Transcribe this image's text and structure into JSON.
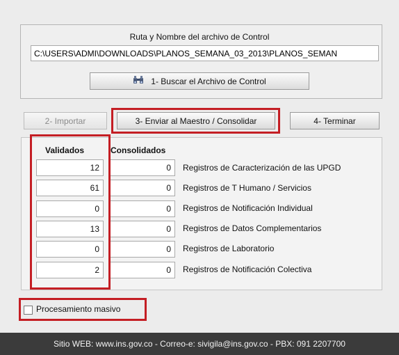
{
  "control_file": {
    "label": "Ruta y Nombre del archivo de Control",
    "path_value": "C:\\USERS\\ADMI\\DOWNLOADS\\PLANOS_SEMANA_03_2013\\PLANOS_SEMAN",
    "search_button": "1- Buscar el Archivo de Control",
    "search_icon": "binoculars-icon"
  },
  "actions": {
    "import": "2- Importar",
    "send": "3- Enviar al Maestro / Consolidar",
    "finish": "4- Terminar"
  },
  "counts": {
    "header_validated": "Validados",
    "header_consolidated": "Consolidados",
    "rows": [
      {
        "validated": "12",
        "consolidated": "0",
        "label": "Registros de Caracterización de las UPGD"
      },
      {
        "validated": "61",
        "consolidated": "0",
        "label": "Registros de T Humano / Servicios"
      },
      {
        "validated": "0",
        "consolidated": "0",
        "label": "Registros de Notificación Individual"
      },
      {
        "validated": "13",
        "consolidated": "0",
        "label": "Registros de Datos Complementarios"
      },
      {
        "validated": "0",
        "consolidated": "0",
        "label": "Registros de Laboratorio"
      },
      {
        "validated": "2",
        "consolidated": "0",
        "label": "Registros de Notificación Colectiva"
      }
    ]
  },
  "mass_processing": {
    "label": "Procesamiento masivo",
    "checked": false
  },
  "footer": {
    "text": "Sitio WEB: www.ins.gov.co - Correo-e: sivigila@ins.gov.co - PBX: 091 2207700"
  },
  "colors": {
    "highlight": "#c41e24",
    "footer_bg": "#3b3b3b"
  }
}
